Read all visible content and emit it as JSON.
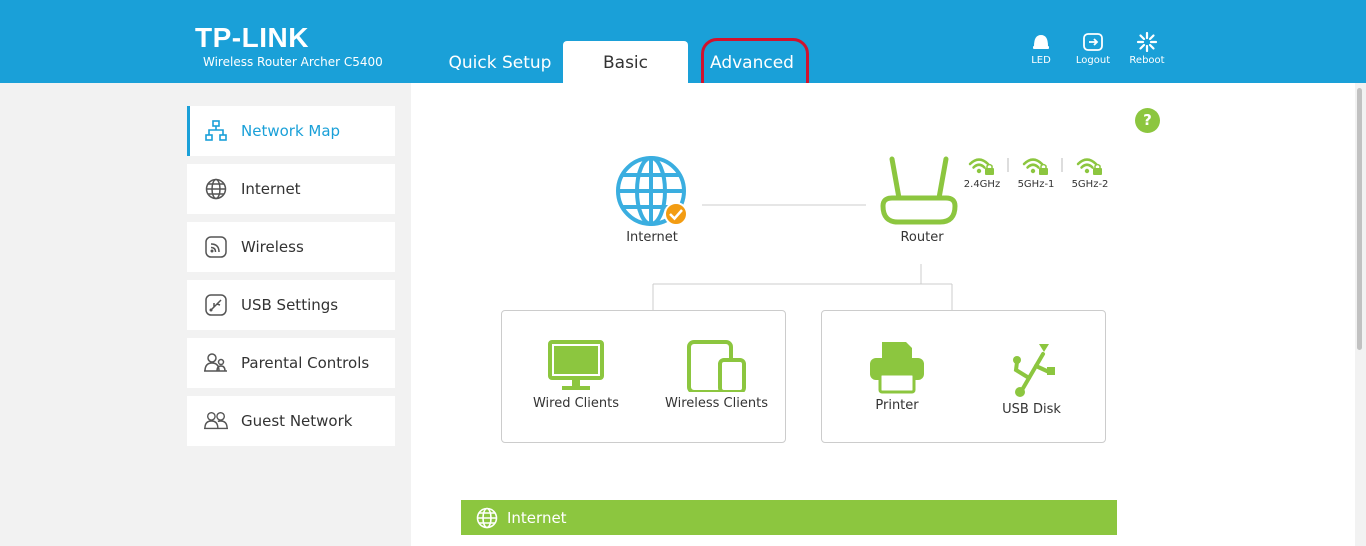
{
  "header": {
    "brand": "TP-LINK",
    "model": "Wireless Router Archer C5400",
    "tabs": {
      "quick_setup": "Quick Setup",
      "basic": "Basic",
      "advanced": "Advanced"
    },
    "buttons": {
      "led": "LED",
      "logout": "Logout",
      "reboot": "Reboot"
    }
  },
  "sidebar": {
    "items": [
      {
        "label": "Network Map",
        "icon": "network-map-icon",
        "active": true
      },
      {
        "label": "Internet",
        "icon": "globe-icon"
      },
      {
        "label": "Wireless",
        "icon": "wireless-icon"
      },
      {
        "label": "USB Settings",
        "icon": "usb-icon"
      },
      {
        "label": "Parental Controls",
        "icon": "parental-controls-icon"
      },
      {
        "label": "Guest Network",
        "icon": "guest-network-icon"
      }
    ]
  },
  "map": {
    "internet": "Internet",
    "router": "Router",
    "bands": [
      "2.4GHz",
      "5GHz-1",
      "5GHz-2"
    ],
    "clients": {
      "wired": "Wired Clients",
      "wireless": "Wireless Clients",
      "printer": "Printer",
      "usb_disk": "USB Disk"
    }
  },
  "section": {
    "title": "Internet"
  },
  "help": "?",
  "colors": {
    "header": "#1aa0d8",
    "green": "#8cc63f",
    "orange": "#f39c12",
    "highlight": "#d0122e"
  }
}
